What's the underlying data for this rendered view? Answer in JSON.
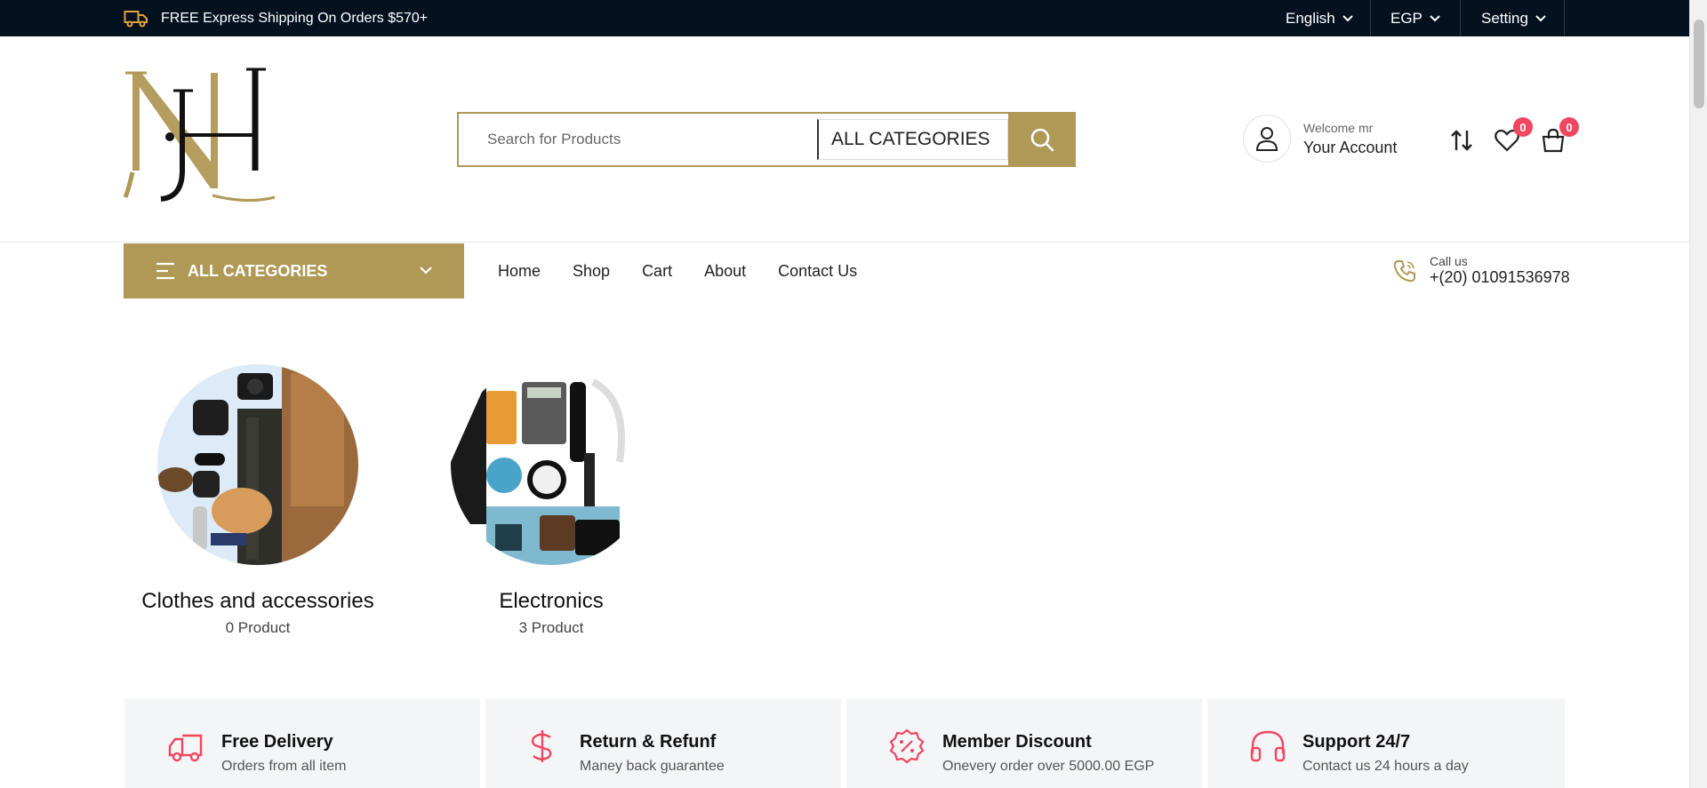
{
  "topbar": {
    "shipping_text": "FREE Express Shipping On Orders $570+",
    "language": "English",
    "currency": "EGP",
    "setting": "Setting"
  },
  "header": {
    "search_placeholder": "Search for Products",
    "search_category": "ALL CATEGORIES",
    "welcome": "Welcome mr",
    "account": "Your Account",
    "wishlist_count": "0",
    "cart_count": "0"
  },
  "nav": {
    "all_categories": "ALL CATEGORIES",
    "links": [
      "Home",
      "Shop",
      "Cart",
      "About",
      "Contact Us"
    ],
    "call_label": "Call us",
    "call_number": "+(20) 01091536978"
  },
  "categories": [
    {
      "name": "Clothes and accessories",
      "count": "0 Product"
    },
    {
      "name": "Electronics",
      "count": "3 Product"
    }
  ],
  "features": [
    {
      "title": "Free Delivery",
      "subtitle": "Orders from all item",
      "icon": "truck-icon"
    },
    {
      "title": "Return & Refunf",
      "subtitle": "Maney back guarantee",
      "icon": "dollar-icon"
    },
    {
      "title": "Member Discount",
      "subtitle": "Onevery order over 5000.00 EGP",
      "icon": "percent-badge-icon"
    },
    {
      "title": "Support 24/7",
      "subtitle": "Contact us 24 hours a day",
      "icon": "headphones-icon"
    }
  ],
  "colors": {
    "accent": "#b09856",
    "topbar": "#041220",
    "badge": "#f0465f",
    "feature_icon": "#f0465f"
  }
}
